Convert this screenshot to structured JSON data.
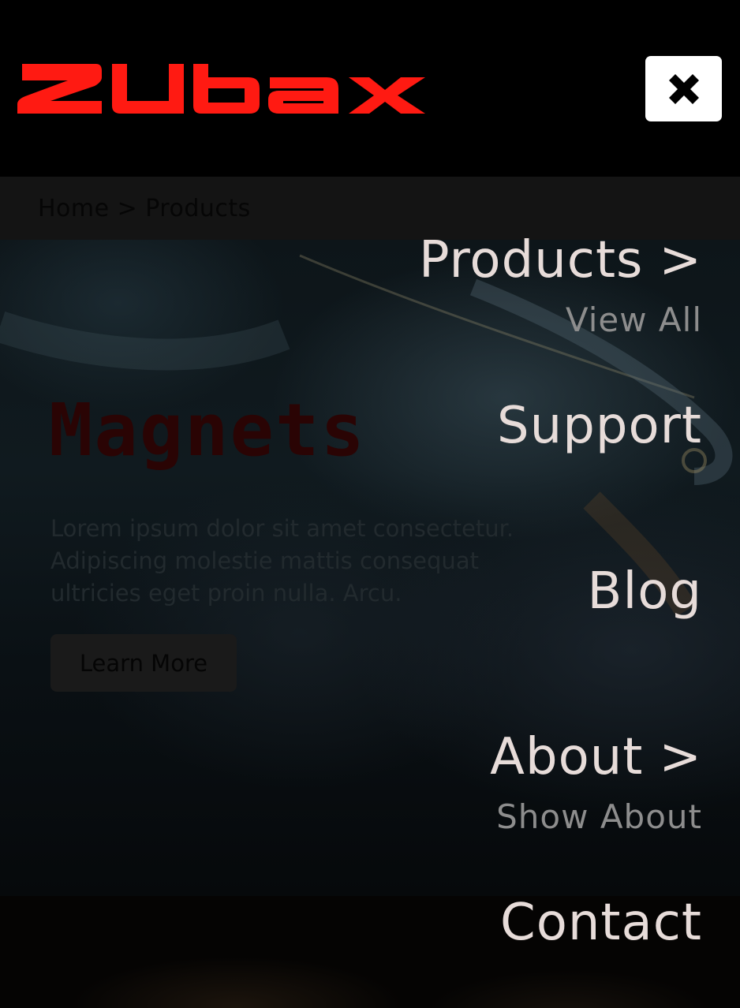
{
  "header": {
    "logo_text": "zubax",
    "close_button_label": "close-icon"
  },
  "breadcrumb": {
    "home": "Home",
    "separator": ">",
    "current": "Products"
  },
  "hero": {
    "title": "Magnets",
    "description": "Lorem ipsum dolor sit amet consectetur. Adipiscing molestie mattis consequat ultricies eget proin nulla. Arcu.",
    "button_label": "Learn More"
  },
  "menu": {
    "products": {
      "label": "Products",
      "chevron": ">",
      "sub": "View All"
    },
    "support": {
      "label": "Support"
    },
    "blog": {
      "label": "Blog"
    },
    "about": {
      "label": "About",
      "chevron": ">",
      "sub": "Show About"
    },
    "contact": {
      "label": "Contact"
    }
  },
  "colors": {
    "brand_red": "#ff1a12",
    "menu_text": "#e7dcd9",
    "menu_sub_text": "#8d8d8d"
  }
}
